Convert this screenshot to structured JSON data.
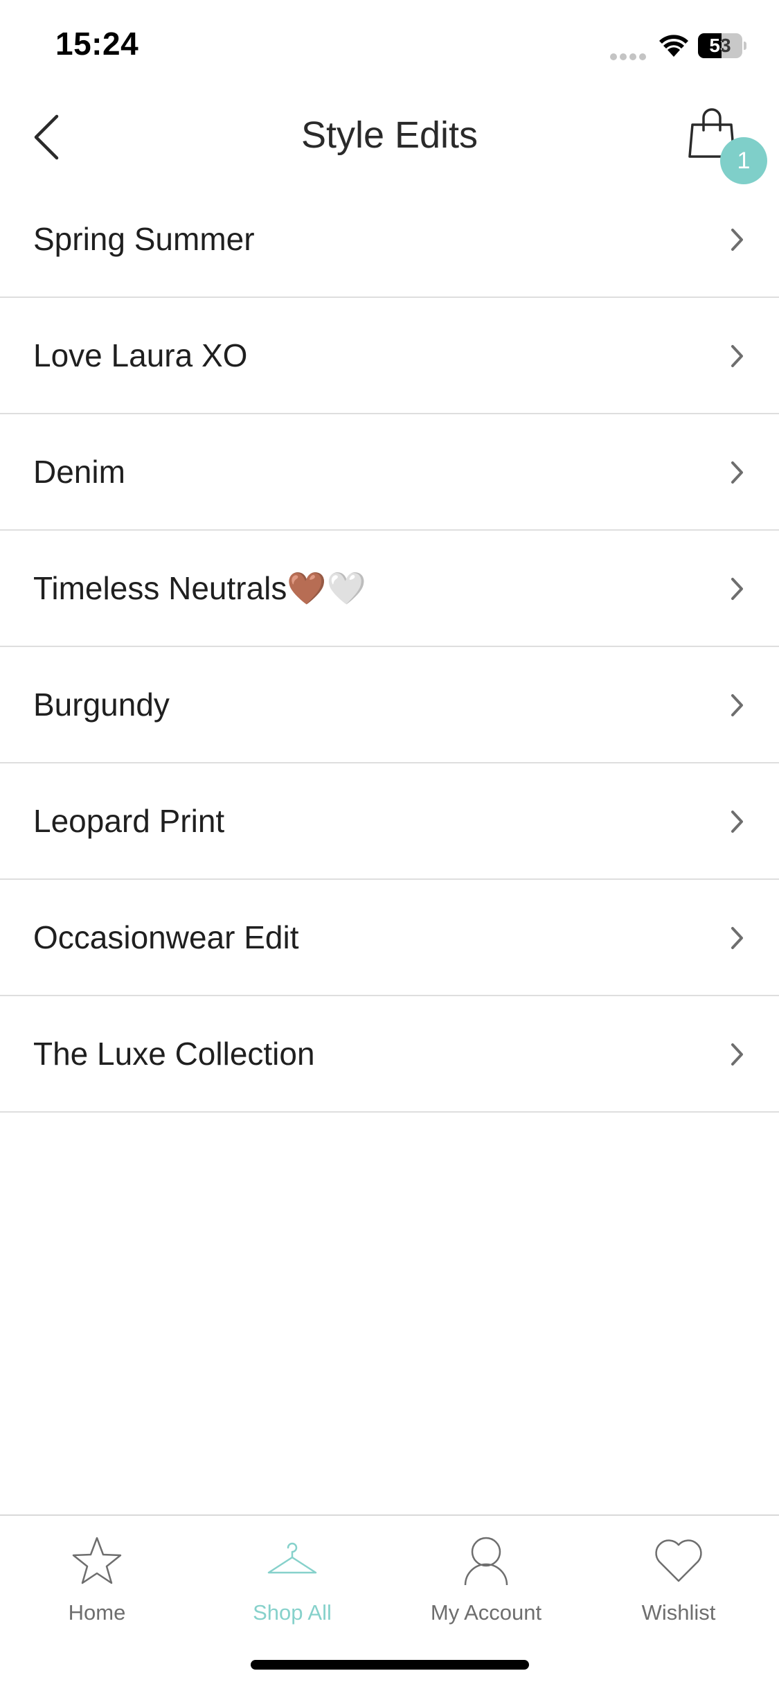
{
  "status_bar": {
    "time": "15:24",
    "battery_text": "53",
    "battery_level_percent": 53,
    "signal_icon": "cellular-signal-icon",
    "wifi_icon": "wifi-icon"
  },
  "header": {
    "title": "Style Edits",
    "back_icon": "chevron-left-icon",
    "cart_icon": "shopping-bag-icon",
    "cart_count": "1"
  },
  "edits": [
    "Spring Summer",
    "Love Laura XO",
    "Denim",
    "Timeless Neutrals🤎🤍",
    "Burgundy",
    "Leopard Print",
    "Occasionwear Edit",
    "The Luxe Collection"
  ],
  "tabs": [
    {
      "label": "Home",
      "icon": "star-icon",
      "active": false
    },
    {
      "label": "Shop All",
      "icon": "hanger-icon",
      "active": true
    },
    {
      "label": "My Account",
      "icon": "person-icon",
      "active": false
    },
    {
      "label": "Wishlist",
      "icon": "heart-icon",
      "active": false
    }
  ],
  "colors": {
    "accent": "#7fcfc9",
    "active_tab": "#86d1cb",
    "text": "#1f1f1f",
    "divider": "#dedede",
    "inactive_tab": "#6e6e6e"
  }
}
